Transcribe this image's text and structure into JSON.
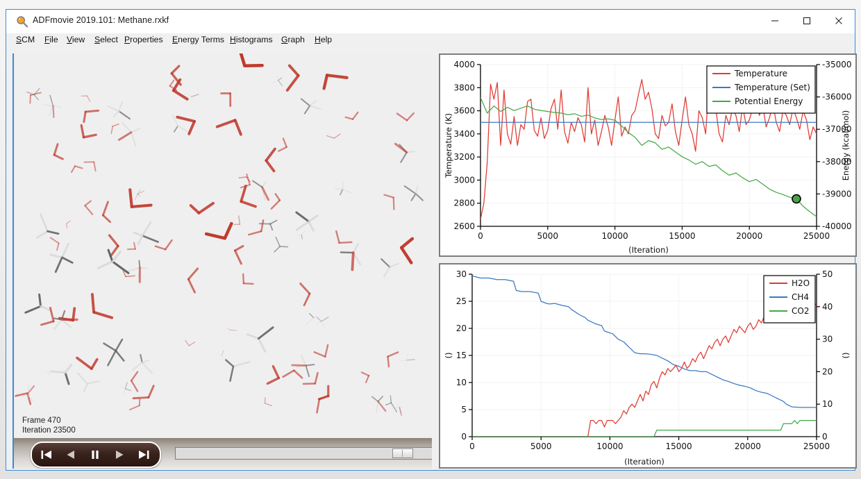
{
  "window": {
    "title": "ADFmovie 2019.101: Methane.rxkf",
    "icon": "magnifier-icon",
    "accent_color": "#3b8ad8",
    "controls": {
      "minimize": "minimize-icon",
      "maximize": "maximize-icon",
      "close": "close-icon"
    }
  },
  "menu": {
    "items": [
      {
        "label": "SCM",
        "accel": "S"
      },
      {
        "label": "File",
        "accel": "F"
      },
      {
        "label": "View",
        "accel": "V"
      },
      {
        "label": "Select",
        "accel": "S"
      },
      {
        "label": "Properties",
        "accel": "P"
      },
      {
        "label": "Energy Terms",
        "accel": "E"
      },
      {
        "label": "Histograms",
        "accel": "H"
      },
      {
        "label": "Graph",
        "accel": "G"
      },
      {
        "label": "Help",
        "accel": "H"
      }
    ]
  },
  "viewport": {
    "frame_label": "Frame 470",
    "iteration_label": "Iteration 23500",
    "background_color": "#efeff0",
    "bond_colors": {
      "oxygen": "#c0392b",
      "carbon": "#555555",
      "hydrogen": "#d8d8d8"
    }
  },
  "playback": {
    "buttons": [
      {
        "name": "skip-to-start-button",
        "icon": "skip-back-icon"
      },
      {
        "name": "step-back-button",
        "icon": "rewind-icon"
      },
      {
        "name": "pause-button",
        "icon": "pause-icon"
      },
      {
        "name": "play-button",
        "icon": "play-icon"
      },
      {
        "name": "skip-to-end-button",
        "icon": "skip-forward-icon"
      }
    ],
    "slider": {
      "name": "frame-slider",
      "value_percent": 84
    }
  },
  "chart_data": [
    {
      "id": "top",
      "type": "line",
      "title": "",
      "xlabel": "(Iteration)",
      "ylabel": "Temperature (K)",
      "y2label": "Energy (kcal/mol)",
      "xlim": [
        0,
        25000
      ],
      "ylim": [
        2600,
        4000
      ],
      "y2lim": [
        -40000,
        -35000
      ],
      "xticks": [
        0,
        5000,
        10000,
        15000,
        20000,
        25000
      ],
      "yticks": [
        2600,
        2800,
        3000,
        3200,
        3400,
        3600,
        3800,
        4000
      ],
      "y2ticks": [
        -40000,
        -39000,
        -38000,
        -37000,
        -36000,
        -35000
      ],
      "grid": true,
      "legend_position": "top-right",
      "marker": {
        "x": 23500,
        "y": -39150,
        "axis": "y2",
        "color": "#4aa34a",
        "edge": "#000000"
      },
      "series": [
        {
          "name": "Temperature",
          "color": "#e03a32",
          "axis": "y1",
          "x": [
            0,
            250,
            500,
            750,
            1000,
            1250,
            1500,
            1750,
            2000,
            2250,
            2500,
            2750,
            3000,
            3250,
            3500,
            3750,
            4000,
            4250,
            4500,
            4750,
            5000,
            5250,
            5500,
            5750,
            6000,
            6250,
            6500,
            6750,
            7000,
            7250,
            7500,
            7750,
            8000,
            8250,
            8500,
            8750,
            9000,
            9250,
            9500,
            9750,
            10000,
            10250,
            10500,
            10750,
            11000,
            11250,
            11500,
            11750,
            12000,
            12250,
            12500,
            12750,
            13000,
            13250,
            13500,
            13750,
            14000,
            14250,
            14500,
            14750,
            15000,
            15250,
            15500,
            15750,
            16000,
            16250,
            16500,
            16750,
            17000,
            17250,
            17500,
            17750,
            18000,
            18250,
            18500,
            18750,
            19000,
            19250,
            19500,
            19750,
            20000,
            20250,
            20500,
            20750,
            21000,
            21250,
            21500,
            21750,
            22000,
            22250,
            22500,
            22750,
            23000,
            23250,
            23500,
            23750,
            24000,
            24250,
            24500,
            24750,
            25000
          ],
          "y": [
            2660,
            2800,
            3150,
            3830,
            3700,
            3845,
            3300,
            3780,
            3400,
            3310,
            3550,
            3300,
            3480,
            3440,
            3680,
            3700,
            3430,
            3380,
            3540,
            3360,
            3430,
            3620,
            3700,
            3440,
            3780,
            3420,
            3320,
            3500,
            3420,
            3540,
            3480,
            3330,
            3800,
            3400,
            3520,
            3300,
            3420,
            3560,
            3460,
            3300,
            3520,
            3720,
            3380,
            3460,
            3400,
            3560,
            3600,
            3740,
            3870,
            3700,
            3760,
            3620,
            3400,
            3360,
            3560,
            3470,
            3500,
            3660,
            3420,
            3300,
            3520,
            3720,
            3480,
            3400,
            3250,
            3600,
            3540,
            3400,
            3840,
            3700,
            3620,
            3400,
            3330,
            3560,
            3480,
            3620,
            3560,
            3420,
            3640,
            3480,
            3520,
            3620,
            3700,
            3560,
            3640,
            3460,
            3540,
            3660,
            3500,
            3420,
            3600,
            3560,
            3480,
            3620,
            3540,
            3440,
            3600,
            3520,
            3350,
            3460,
            3400
          ]
        },
        {
          "name": "Temperature (Set)",
          "color": "#3a78c2",
          "axis": "y1",
          "x": [
            0,
            25000
          ],
          "y": [
            3500,
            3500
          ]
        },
        {
          "name": "Potential Energy",
          "color": "#45a845",
          "axis": "y2",
          "x": [
            0,
            500,
            1000,
            1500,
            2000,
            2500,
            3000,
            3500,
            4000,
            4500,
            5000,
            5500,
            6000,
            6500,
            7000,
            7500,
            8000,
            8500,
            9000,
            9500,
            10000,
            10500,
            11000,
            11500,
            12000,
            12500,
            13000,
            13500,
            14000,
            14500,
            15000,
            15500,
            16000,
            16500,
            17000,
            17500,
            18000,
            18500,
            19000,
            19500,
            20000,
            20500,
            21000,
            21500,
            22000,
            22500,
            23000,
            23500,
            24000,
            24500,
            25000
          ],
          "y": [
            -36020,
            -36500,
            -36280,
            -36450,
            -36320,
            -36420,
            -36350,
            -36280,
            -36380,
            -36420,
            -36450,
            -36480,
            -36500,
            -36550,
            -36520,
            -36600,
            -36560,
            -36650,
            -36700,
            -36680,
            -36720,
            -36900,
            -37100,
            -37250,
            -37500,
            -37350,
            -37420,
            -37620,
            -37550,
            -37700,
            -37850,
            -37950,
            -38080,
            -38000,
            -38150,
            -38100,
            -38280,
            -38420,
            -38350,
            -38500,
            -38620,
            -38550,
            -38700,
            -38850,
            -38950,
            -39020,
            -39100,
            -39150,
            -39380,
            -39550,
            -39700
          ]
        }
      ]
    },
    {
      "id": "bottom",
      "type": "line",
      "title": "",
      "xlabel": "(Iteration)",
      "ylabel": "()",
      "y2label": "()",
      "xlim": [
        0,
        25000
      ],
      "ylim": [
        0,
        30
      ],
      "y2lim": [
        0,
        50
      ],
      "xticks": [
        0,
        5000,
        10000,
        15000,
        20000,
        25000
      ],
      "yticks": [
        0,
        5,
        10,
        15,
        20,
        25,
        30
      ],
      "y2ticks": [
        0,
        10,
        20,
        30,
        40,
        50
      ],
      "grid": true,
      "legend_position": "top-right",
      "series": [
        {
          "name": "H2O",
          "color": "#e03a32",
          "axis": "y2",
          "x": [
            0,
            8400,
            8600,
            8800,
            9000,
            9200,
            9400,
            9600,
            9800,
            10000,
            10200,
            10400,
            10600,
            10800,
            11000,
            11200,
            11400,
            11600,
            11800,
            12000,
            12200,
            12400,
            12600,
            12800,
            13000,
            13200,
            13400,
            13600,
            13800,
            14000,
            14200,
            14400,
            14600,
            14800,
            15000,
            15200,
            15400,
            15600,
            15800,
            16000,
            16200,
            16400,
            16600,
            16800,
            17000,
            17200,
            17400,
            17600,
            17800,
            18000,
            18200,
            18400,
            18600,
            18800,
            19000,
            19200,
            19400,
            19600,
            19800,
            20000,
            20200,
            20400,
            20600,
            20800,
            21000,
            21200,
            21400,
            21600,
            21800,
            22000,
            22200,
            22400,
            22600,
            22800,
            23000,
            23200,
            23400,
            23600,
            23800,
            24000,
            24200,
            24400,
            24600,
            24800,
            25000
          ],
          "y": [
            0,
            0,
            5,
            5,
            4,
            5,
            5,
            3,
            5,
            5,
            5,
            4,
            5,
            6,
            8,
            7,
            9,
            10,
            9,
            11,
            13,
            11,
            14,
            13,
            16,
            17,
            15,
            18,
            20,
            19,
            21,
            20,
            21,
            22,
            20,
            21,
            23,
            21,
            22,
            24,
            23,
            25,
            26,
            24,
            26,
            28,
            27,
            29,
            30,
            28,
            30,
            31,
            29,
            31,
            33,
            32,
            34,
            33,
            32,
            34,
            35,
            33,
            34,
            36,
            35,
            37,
            36,
            38,
            37,
            39,
            38,
            40,
            39,
            41,
            40,
            42,
            41,
            43,
            42,
            41,
            43,
            42,
            41,
            40,
            41
          ]
        },
        {
          "name": "CH4",
          "color": "#3a78c2",
          "axis": "y1",
          "x": [
            0,
            600,
            1200,
            1800,
            2400,
            3000,
            3200,
            3600,
            4200,
            4800,
            5000,
            5400,
            5600,
            6000,
            6600,
            7000,
            7200,
            7800,
            8200,
            8400,
            9000,
            9400,
            9600,
            10200,
            10600,
            11000,
            11400,
            11800,
            12200,
            12600,
            13000,
            13400,
            13800,
            14200,
            14600,
            15000,
            15400,
            15800,
            16200,
            16600,
            17000,
            17400,
            17800,
            18200,
            18600,
            19000,
            19400,
            19800,
            20200,
            20600,
            21000,
            21400,
            21800,
            22200,
            22600,
            22800,
            23200,
            23800,
            24400,
            25000
          ],
          "y": [
            29.7,
            29.3,
            29.3,
            29.0,
            29.0,
            28.7,
            27.0,
            26.8,
            26.8,
            26.5,
            25.0,
            24.6,
            24.5,
            24.6,
            24.2,
            24.0,
            23.5,
            22.5,
            22.0,
            21.5,
            20.8,
            20.5,
            19.5,
            19.0,
            18.0,
            17.5,
            16.5,
            15.5,
            15.3,
            15.3,
            15.2,
            15.0,
            14.5,
            14.0,
            13.3,
            13.0,
            12.5,
            12.2,
            12.2,
            12.0,
            12.0,
            11.5,
            11.0,
            10.5,
            10.2,
            9.8,
            9.5,
            9.3,
            9.0,
            8.5,
            8.2,
            8.0,
            7.5,
            7.0,
            6.5,
            6.0,
            5.5,
            5.4,
            5.4,
            5.4
          ]
        },
        {
          "name": "CO2",
          "color": "#3daa4a",
          "axis": "y2",
          "x": [
            0,
            13200,
            13400,
            16000,
            18000,
            20000,
            22000,
            22400,
            22600,
            23200,
            23400,
            23600,
            23800,
            24000,
            25000
          ],
          "y": [
            0,
            0,
            2,
            2,
            2,
            2,
            2,
            2,
            4,
            4,
            5,
            4,
            5,
            5,
            5
          ]
        }
      ]
    }
  ]
}
